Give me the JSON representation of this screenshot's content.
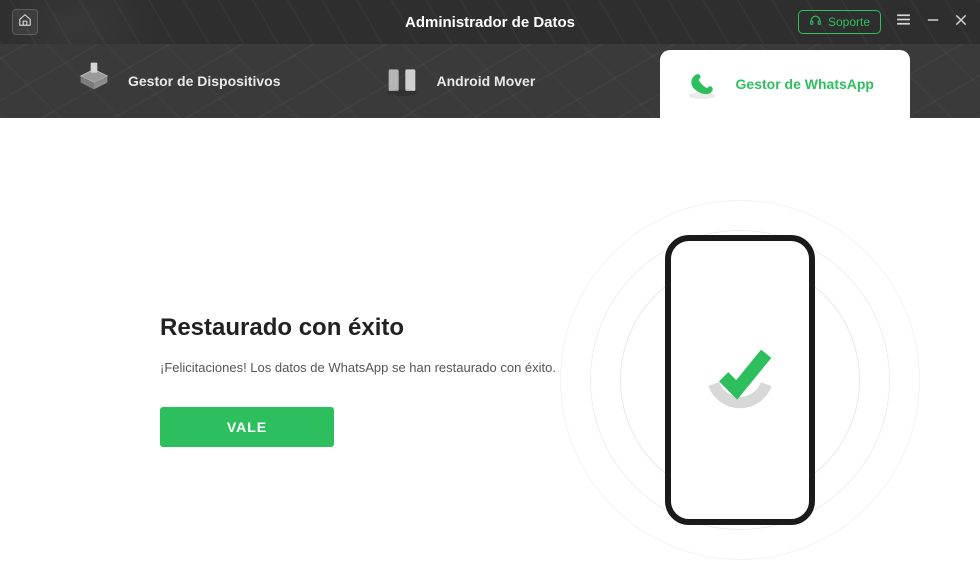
{
  "header": {
    "title": "Administrador de Datos",
    "support_label": "Soporte"
  },
  "tabs": {
    "device_manager": "Gestor de Dispositivos",
    "android_mover": "Android Mover",
    "whatsapp_manager": "Gestor de WhatsApp"
  },
  "content": {
    "heading": "Restaurado con éxito",
    "message": "¡Felicitaciones! Los datos de WhatsApp se han restaurado con éxito.",
    "ok_label": "VALE"
  },
  "colors": {
    "accent": "#2dbf5e"
  }
}
